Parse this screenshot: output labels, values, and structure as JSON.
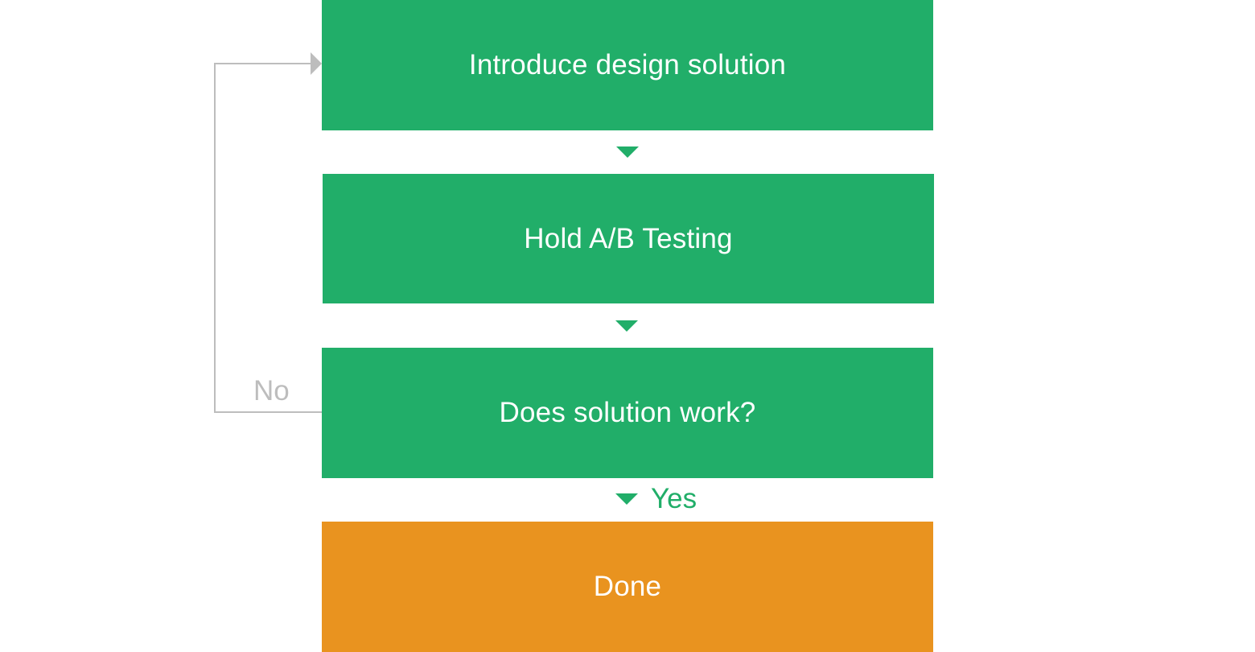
{
  "colors": {
    "step_green": "#21ae69",
    "done_orange": "#e9931f",
    "loop_gray": "#bdbdbd",
    "text_white": "#ffffff"
  },
  "flow": {
    "steps": [
      {
        "label": "Introduce design solution"
      },
      {
        "label": "Hold A/B Testing"
      },
      {
        "label": "Does solution work?"
      },
      {
        "label": "Done"
      }
    ],
    "yes_label": "Yes",
    "no_label": "No"
  }
}
